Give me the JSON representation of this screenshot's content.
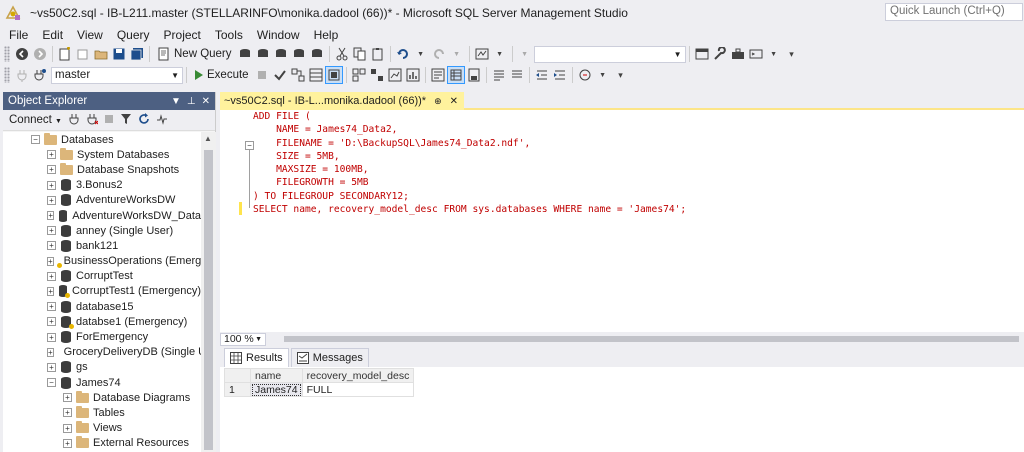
{
  "window": {
    "title": "~vs50C2.sql - IB-L211.master (STELLARINFO\\monika.dadool (66))* - Microsoft SQL Server Management Studio",
    "quick_launch_placeholder": "Quick Launch (Ctrl+Q)"
  },
  "menu": [
    "File",
    "Edit",
    "View",
    "Query",
    "Project",
    "Tools",
    "Window",
    "Help"
  ],
  "toolbar1": {
    "new_query_label": "New Query"
  },
  "toolbar2": {
    "database_selected": "master",
    "execute_label": "Execute"
  },
  "object_explorer": {
    "title": "Object Explorer",
    "connect_label": "Connect",
    "tree": [
      {
        "label": "Databases",
        "kind": "folder",
        "level": 0,
        "expanded": true
      },
      {
        "label": "System Databases",
        "kind": "folder",
        "level": 1,
        "expanded": false
      },
      {
        "label": "Database Snapshots",
        "kind": "folder",
        "level": 1,
        "expanded": false
      },
      {
        "label": "3.Bonus2",
        "kind": "db",
        "level": 1,
        "expanded": false
      },
      {
        "label": "AdventureWorksDW",
        "kind": "db",
        "level": 1,
        "expanded": false
      },
      {
        "label": "AdventureWorksDW_Data",
        "kind": "db",
        "level": 1,
        "expanded": false
      },
      {
        "label": "anney (Single User)",
        "kind": "db",
        "level": 1,
        "expanded": false
      },
      {
        "label": "bank121",
        "kind": "db",
        "level": 1,
        "expanded": false
      },
      {
        "label": "BusinessOperations (Emerge",
        "kind": "db-warn",
        "level": 1,
        "expanded": false
      },
      {
        "label": "CorruptTest",
        "kind": "db",
        "level": 1,
        "expanded": false
      },
      {
        "label": "CorruptTest1 (Emergency)",
        "kind": "db-warn",
        "level": 1,
        "expanded": false
      },
      {
        "label": "database15",
        "kind": "db",
        "level": 1,
        "expanded": false
      },
      {
        "label": "databse1 (Emergency)",
        "kind": "db-warn",
        "level": 1,
        "expanded": false
      },
      {
        "label": "ForEmergency",
        "kind": "db",
        "level": 1,
        "expanded": false
      },
      {
        "label": "GroceryDeliveryDB (Single U",
        "kind": "db",
        "level": 1,
        "expanded": false
      },
      {
        "label": "gs",
        "kind": "db",
        "level": 1,
        "expanded": false
      },
      {
        "label": "James74",
        "kind": "db",
        "level": 1,
        "expanded": true
      },
      {
        "label": "Database Diagrams",
        "kind": "folder",
        "level": 2,
        "expanded": false
      },
      {
        "label": "Tables",
        "kind": "folder",
        "level": 2,
        "expanded": false
      },
      {
        "label": "Views",
        "kind": "folder",
        "level": 2,
        "expanded": false
      },
      {
        "label": "External Resources",
        "kind": "folder",
        "level": 2,
        "expanded": false
      }
    ]
  },
  "document_tab": {
    "label": "~vs50C2.sql - IB-L...monika.dadool (66))*"
  },
  "editor": {
    "lines": [
      "ADD FILE (",
      "    NAME = James74_Data2,",
      "    FILENAME = 'D:\\BackupSQL\\James74_Data2.ndf',",
      "    SIZE = 5MB,",
      "    MAXSIZE = 100MB,",
      "    FILEGROWTH = 5MB",
      ") TO FILEGROUP SECONDARY12;",
      "SELECT name, recovery_model_desc FROM sys.databases WHERE name = 'James74';"
    ]
  },
  "zoom": {
    "value": "100 %"
  },
  "results": {
    "tabs": [
      "Results",
      "Messages"
    ],
    "columns": [
      "name",
      "recovery_model_desc"
    ],
    "rows": [
      {
        "num": "1",
        "name": "James74",
        "recovery_model_desc": "FULL"
      }
    ]
  }
}
